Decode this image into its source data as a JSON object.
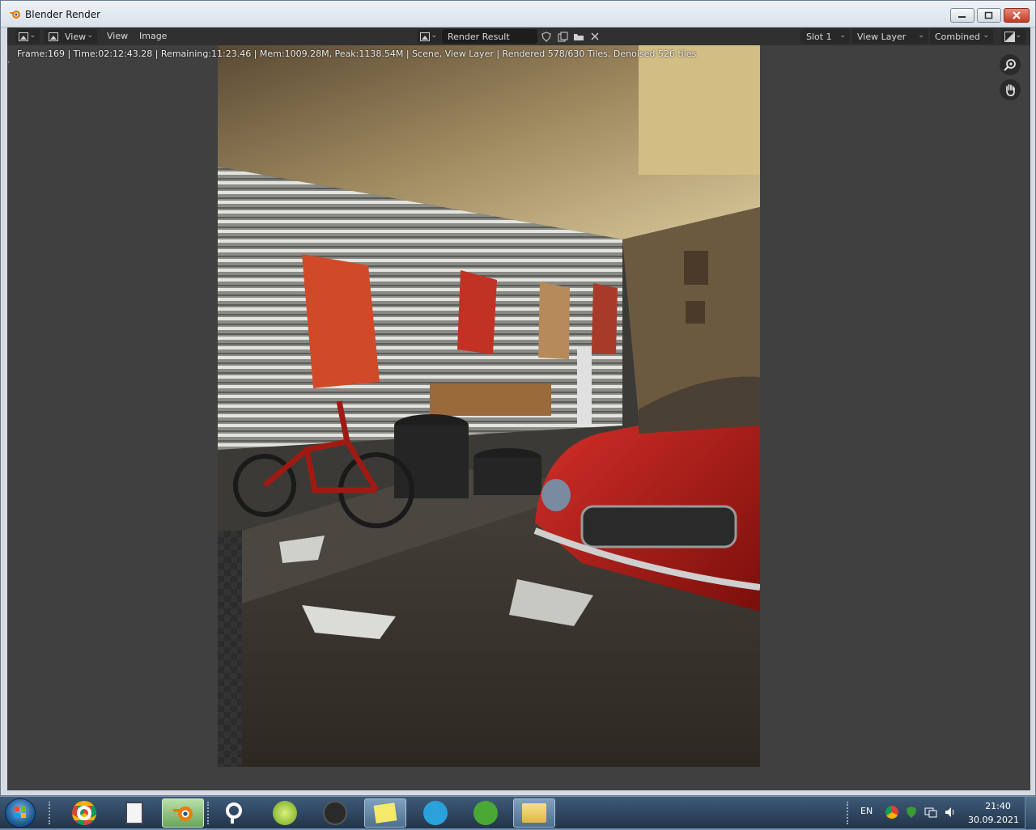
{
  "window": {
    "title": "Blender Render",
    "controls": {
      "minimize": "minimize",
      "maximize": "maximize",
      "close": "close"
    }
  },
  "header": {
    "editor_type_icon": "image-editor-icon",
    "view_mode_label": "View",
    "menus": [
      "View",
      "Image"
    ],
    "image_name": "Render Result",
    "slot": "Slot 1",
    "view_layer": "View Layer",
    "pass": "Combined"
  },
  "stats": {
    "text": "Frame:169 | Time:02:12:43.28 | Remaining:11:23.46 | Mem:1009.28M, Peak:1138.54M | Scene, View Layer | Rendered 578/630 Tiles, Denoised 526 tiles"
  },
  "navigation": {
    "zoom_icon": "zoom-icon",
    "pan_icon": "hand-pan-icon"
  },
  "colors": {
    "editor_bg": "#404040",
    "header_bg": "#303030",
    "car_red": "#b01a14"
  },
  "taskbar": {
    "apps": [
      "chrome",
      "notepad",
      "blender",
      "search-app",
      "lime-app",
      "vector-app",
      "sticky-notes",
      "telegram",
      "utorrent",
      "file-explorer"
    ],
    "language": "EN",
    "time": "21:40",
    "date": "30.09.2021"
  }
}
